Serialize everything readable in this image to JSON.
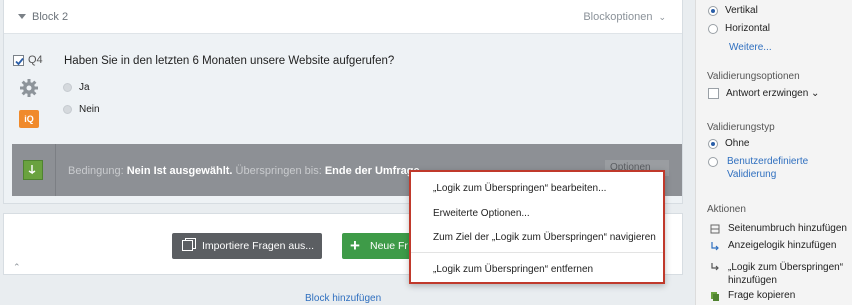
{
  "block": {
    "title": "Block 2",
    "options_label": "Blockoptionen"
  },
  "question": {
    "number": "Q4",
    "text": "Haben Sie in den letzten 6 Monaten unsere Website aufgerufen?",
    "choices": [
      "Ja",
      "Nein"
    ],
    "iq_badge": "iQ"
  },
  "logic": {
    "condition_label": "Bedingung:",
    "condition_value": "Nein Ist ausgewählt.",
    "skip_label": "Überspringen bis:",
    "skip_value": "Ende der Umfrage",
    "options_label": "Optionen"
  },
  "context_menu": {
    "items": [
      "„Logik zum Überspringen“ bearbeiten...",
      "Erweiterte Optionen...",
      "Zum Ziel der „Logik zum Überspringen“ navigieren",
      "„Logik zum Überspringen“ entfernen"
    ]
  },
  "buttons": {
    "import": "Importiere Fragen aus...",
    "new_question": "Neue Fr"
  },
  "add_block": "Block hinzufügen",
  "panel": {
    "orientation_options": [
      "Vertikal",
      "Horizontal"
    ],
    "more_link": "Weitere...",
    "validation_options_heading": "Validierungsoptionen",
    "force_response": "Antwort erzwingen",
    "validation_type_heading": "Validierungstyp",
    "validation_types": [
      "Ohne",
      "Benutzerdefinierte",
      "Validierung"
    ],
    "actions_heading": "Aktionen",
    "actions": [
      "Seitenumbruch hinzufügen",
      "Anzeigelogik hinzufügen",
      "„Logik zum Überspringen“",
      "hinzufügen",
      "Frage kopieren"
    ]
  },
  "colors": {
    "accent_blue": "#2f6fbf",
    "logic_green": "#6aa23f",
    "new_button_green": "#3e9b48",
    "menu_border_red": "#c0392b",
    "iq_orange": "#f08a2b"
  }
}
